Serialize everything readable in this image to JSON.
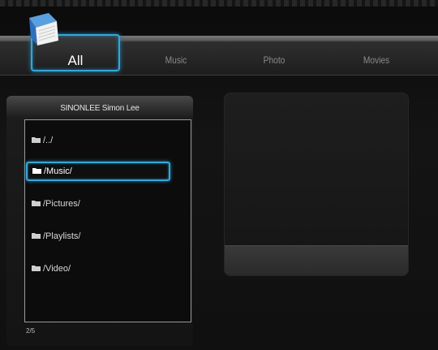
{
  "tabs": {
    "all": "All",
    "music": "Music",
    "photo": "Photo",
    "movies": "Movies"
  },
  "browser": {
    "device_title": "SINONLEE Simon Lee",
    "items": [
      {
        "label": "/../"
      },
      {
        "label": "/Music/"
      },
      {
        "label": "/Pictures/"
      },
      {
        "label": "/Playlists/"
      },
      {
        "label": "/Video/"
      }
    ],
    "selected_index": 1,
    "page_count": "2/5"
  },
  "icons": {
    "app": "media-library-icon",
    "folder": "folder-icon"
  },
  "colors": {
    "highlight": "#36a6d6",
    "text": "#d8d8d8",
    "inactive_tab": "#8a8a8a"
  }
}
